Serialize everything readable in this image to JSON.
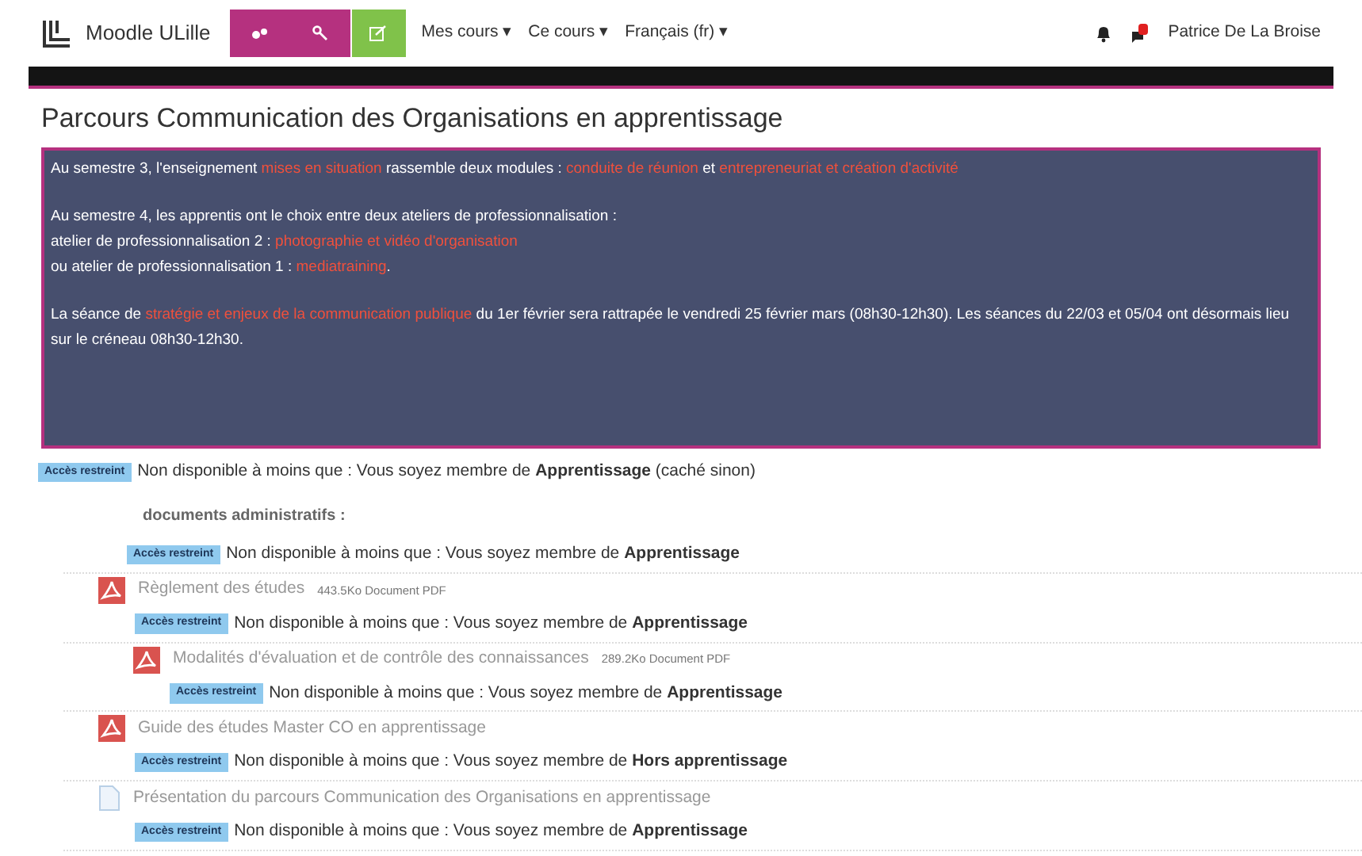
{
  "navbar": {
    "brand": "Moodle ULille",
    "menus": [
      {
        "label": "Mes cours",
        "caret": "▾"
      },
      {
        "label": "Ce cours",
        "caret": "▾"
      },
      {
        "label": "Français (fr)",
        "caret": "▾"
      }
    ],
    "user": "Patrice De La Broise"
  },
  "page_title": "Parcours Communication des Organisations en apprentissage",
  "summary": [
    [
      {
        "text": "Au semestre 3, l'enseignement ",
        "highlight": false
      },
      {
        "text": "mises en situation",
        "highlight": true
      },
      {
        "text": " rassemble deux modules : ",
        "highlight": false
      },
      {
        "text": "conduite de réunion",
        "highlight": true
      },
      {
        "text": " et ",
        "highlight": false
      },
      {
        "text": "entrepreneuriat et création d'activité",
        "highlight": true
      }
    ],
    [
      {
        "text": "Au semestre 4, les apprentis ont le choix entre deux ateliers de professionnalisation :",
        "highlight": false
      }
    ],
    [
      {
        "text": "atelier de professionnalisation 2 : ",
        "highlight": false
      },
      {
        "text": "photographie et vidéo d'organisation",
        "highlight": true
      }
    ],
    [
      {
        "text": "ou atelier de professionnalisation 1 : ",
        "highlight": false
      },
      {
        "text": "mediatraining",
        "highlight": true
      },
      {
        "text": ".",
        "highlight": false
      }
    ],
    [
      {
        "text": "La séance de ",
        "highlight": false
      },
      {
        "text": "stratégie et enjeux de la communication publique",
        "highlight": true
      },
      {
        "text": " du 1er février sera rattrapée le vendredi 25 février mars (08h30-12h30). Les séances du 22/03 et 05/04 ont désormais lieu sur le créneau 08h30-12h30.",
        "highlight": false
      }
    ]
  ],
  "section_restriction": {
    "badge": "Accès restreint",
    "text": "Non disponible à moins que : Vous soyez membre de **Apprentissage** (caché sinon)"
  },
  "activities": [
    {
      "kind": "label",
      "name": "documents administratifs :",
      "restriction": {
        "badge": "Accès restreint",
        "text": "Non disponible à moins que : Vous soyez membre de **Apprentissage**"
      }
    },
    {
      "kind": "pdf",
      "name": "Règlement des études",
      "info": "443.5Ko Document PDF",
      "restriction": {
        "badge": "Accès restreint",
        "text": "Non disponible à moins que : Vous soyez membre de **Apprentissage**"
      },
      "children": [
        {
          "kind": "pdf",
          "name": "Modalités d'évaluation et de contrôle des connaissances",
          "info": "289.2Ko Document PDF",
          "restriction": {
            "badge": "Accès restreint",
            "text": "Non disponible à moins que : Vous soyez membre de **Apprentissage**"
          }
        }
      ]
    },
    {
      "kind": "pdf",
      "name": "Guide des études Master CO en apprentissage",
      "restriction": {
        "badge": "Accès restreint",
        "text": "Non disponible à moins que : Vous soyez membre de **Hors apprentissage**"
      }
    },
    {
      "kind": "page",
      "name": "Présentation du parcours Communication des Organisations en apprentissage",
      "restriction": {
        "badge": "Accès restreint",
        "text": "Non disponible à moins que : Vous soyez membre de **Apprentissage**"
      }
    }
  ]
}
